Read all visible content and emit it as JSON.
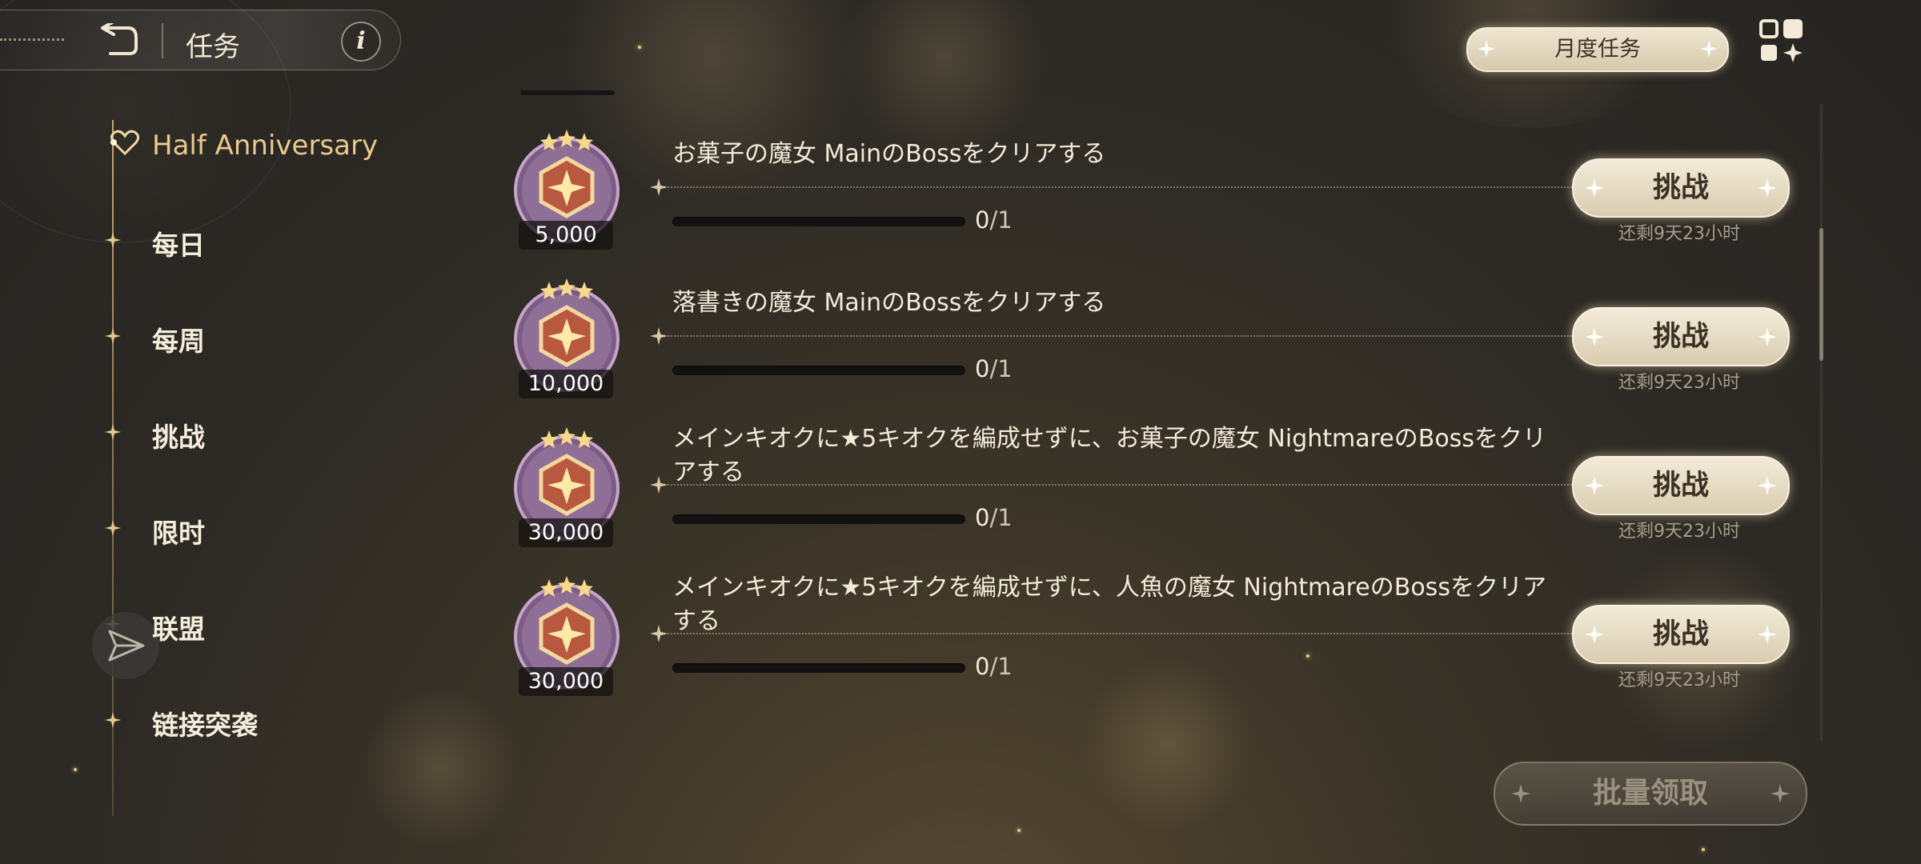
{
  "header": {
    "title": "任务",
    "back_icon": "back-arrow-icon",
    "info_icon": "info-icon",
    "info_glyph": "i"
  },
  "sidebar": {
    "items": [
      {
        "label": "Half Anniversary",
        "active": true
      },
      {
        "label": "每日"
      },
      {
        "label": "每周"
      },
      {
        "label": "挑战"
      },
      {
        "label": "限时"
      },
      {
        "label": "联盟"
      },
      {
        "label": "链接突袭"
      }
    ]
  },
  "top_right": {
    "month_tab": "月度任务",
    "grid_icon": "apps-grid-icon"
  },
  "tasks": [
    {
      "reward": "5,000",
      "title": "お菓子の魔女 MainのBossをクリアする",
      "progress": "0",
      "total": "/1",
      "progress_fraction": 0,
      "button": "挑战",
      "remaining": "还剩9天23小时"
    },
    {
      "reward": "10,000",
      "title": "落書きの魔女 MainのBossをクリアする",
      "progress": "0",
      "total": "/1",
      "progress_fraction": 0,
      "button": "挑战",
      "remaining": "还剩9天23小时"
    },
    {
      "reward": "30,000",
      "title": "メインキオクに★5キオクを編成せずに、お菓子の魔女 NightmareのBossをクリアする",
      "progress": "0",
      "total": "/1",
      "progress_fraction": 0,
      "button": "挑战",
      "remaining": "还剩9天23小时"
    },
    {
      "reward": "30,000",
      "title": "メインキオクに★5キオクを編成せずに、人魚の魔女 NightmareのBossをクリアする",
      "progress": "0",
      "total": "/1",
      "progress_fraction": 0,
      "button": "挑战",
      "remaining": "还剩9天23小时"
    }
  ],
  "batch_claim": "批量领取",
  "colors": {
    "accent_gold": "#e9c98c",
    "button_cream": "#efe6d2",
    "background": "#2d2a25"
  }
}
